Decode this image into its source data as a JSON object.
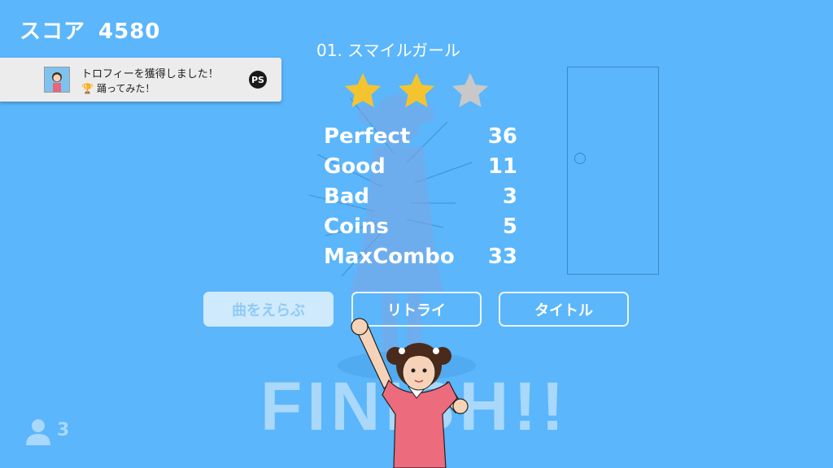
{
  "hud": {
    "score_label": "スコア",
    "score_value": "4580",
    "players_count": "3"
  },
  "song": {
    "title": "01. スマイルガール"
  },
  "trophy": {
    "title": "トロフィーを獲得しました！",
    "name": "踊ってみた！",
    "cup_icon": "trophy-icon",
    "platform_icon": "playstation-icon"
  },
  "rating": {
    "stars_earned": 2,
    "stars_total": 3,
    "star_color": "#f4c430",
    "empty_color": "#c8c8c8"
  },
  "results": [
    {
      "label": "Perfect",
      "value": "36"
    },
    {
      "label": "Good",
      "value": "11"
    },
    {
      "label": "Bad",
      "value": "3"
    },
    {
      "label": "Coins",
      "value": "5"
    },
    {
      "label": "MaxCombo",
      "value": "33"
    }
  ],
  "buttons": {
    "select_song": "曲をえらぶ",
    "retry": "リトライ",
    "title": "タイトル"
  },
  "banner": {
    "text": "FINISH!!"
  },
  "colors": {
    "background": "#5bb6fb"
  }
}
